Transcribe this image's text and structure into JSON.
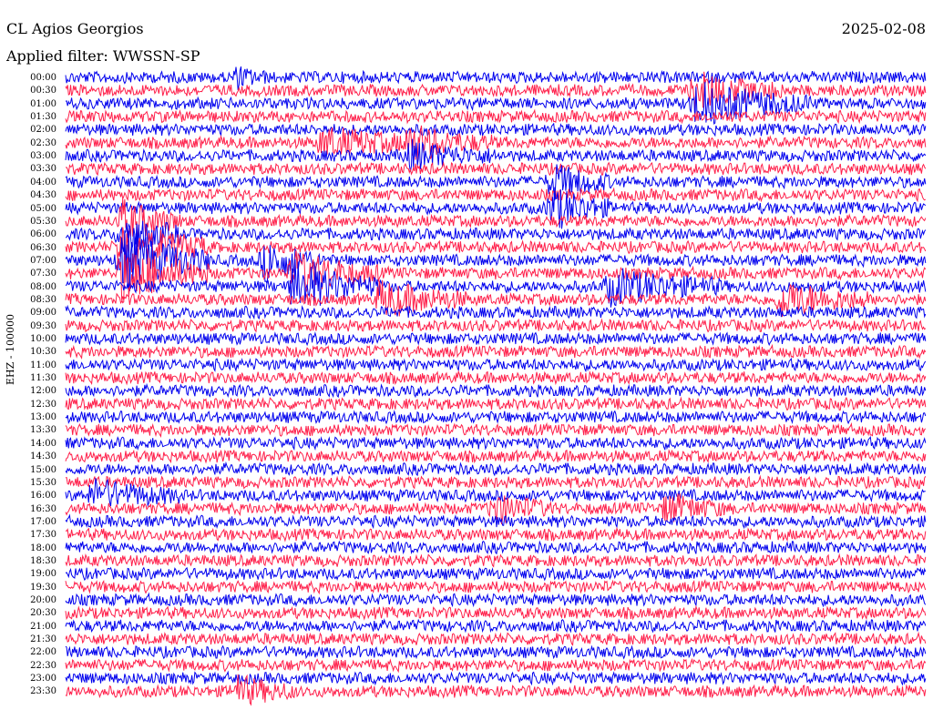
{
  "header": {
    "station": "CL Agios Georgios",
    "date": "2025-02-08",
    "filter": "Applied filter: WWSSN-SP"
  },
  "colors": {
    "trace_a": "#0000ee",
    "trace_b": "#ff1f4a",
    "background": "#ffffff"
  },
  "chart_data": {
    "type": "line",
    "title": "CL Agios Georgios",
    "ylabel": "EHZ - 100000",
    "row_labels": [
      "00:00",
      "00:30",
      "01:00",
      "01:30",
      "02:00",
      "02:30",
      "03:00",
      "03:30",
      "04:00",
      "04:30",
      "05:00",
      "05:30",
      "06:00",
      "06:30",
      "07:00",
      "07:30",
      "08:00",
      "08:30",
      "09:00",
      "09:30",
      "10:00",
      "10:30",
      "11:00",
      "11:30",
      "12:00",
      "12:30",
      "13:00",
      "13:30",
      "14:00",
      "14:30",
      "15:00",
      "15:30",
      "16:00",
      "16:30",
      "17:00",
      "17:30",
      "18:00",
      "18:30",
      "19:00",
      "19:30",
      "20:00",
      "20:30",
      "21:00",
      "21:30",
      "22:00",
      "22:30",
      "23:00",
      "23:30"
    ],
    "row_minutes": 30,
    "grid": false,
    "series": [
      {
        "color": "#0000ee"
      },
      {
        "color": "#ff1f4a"
      }
    ],
    "events": [
      {
        "row": 0,
        "minute": 6,
        "amplitude": 1.2,
        "duration": 1
      },
      {
        "row": 1,
        "minute": 22,
        "amplitude": 2.5,
        "duration": 3
      },
      {
        "row": 2,
        "minute": 22,
        "amplitude": 3.0,
        "duration": 4
      },
      {
        "row": 5,
        "minute": 9,
        "amplitude": 2.0,
        "duration": 4
      },
      {
        "row": 5,
        "minute": 12,
        "amplitude": 2.0,
        "duration": 3
      },
      {
        "row": 6,
        "minute": 12,
        "amplitude": 1.8,
        "duration": 3
      },
      {
        "row": 8,
        "minute": 17,
        "amplitude": 2.5,
        "duration": 2
      },
      {
        "row": 10,
        "minute": 17,
        "amplitude": 3.0,
        "duration": 2
      },
      {
        "row": 11,
        "minute": 2,
        "amplitude": 3.0,
        "duration": 2
      },
      {
        "row": 12,
        "minute": 2,
        "amplitude": 3.0,
        "duration": 2
      },
      {
        "row": 13,
        "minute": 2,
        "amplitude": 4.0,
        "duration": 3
      },
      {
        "row": 14,
        "minute": 2,
        "amplitude": 4.5,
        "duration": 3
      },
      {
        "row": 14,
        "minute": 7,
        "amplitude": 3.0,
        "duration": 2
      },
      {
        "row": 15,
        "minute": 2,
        "amplitude": 4.0,
        "duration": 3
      },
      {
        "row": 15,
        "minute": 8,
        "amplitude": 3.0,
        "duration": 3
      },
      {
        "row": 16,
        "minute": 8,
        "amplitude": 3.5,
        "duration": 3
      },
      {
        "row": 16,
        "minute": 19,
        "amplitude": 2.5,
        "duration": 4
      },
      {
        "row": 17,
        "minute": 11,
        "amplitude": 2.5,
        "duration": 3
      },
      {
        "row": 17,
        "minute": 25,
        "amplitude": 2.5,
        "duration": 3
      },
      {
        "row": 32,
        "minute": 1,
        "amplitude": 2.0,
        "duration": 3
      },
      {
        "row": 33,
        "minute": 15,
        "amplitude": 2.0,
        "duration": 2
      },
      {
        "row": 33,
        "minute": 21,
        "amplitude": 2.0,
        "duration": 2
      },
      {
        "row": 47,
        "minute": 6,
        "amplitude": 2.0,
        "duration": 2
      }
    ]
  }
}
